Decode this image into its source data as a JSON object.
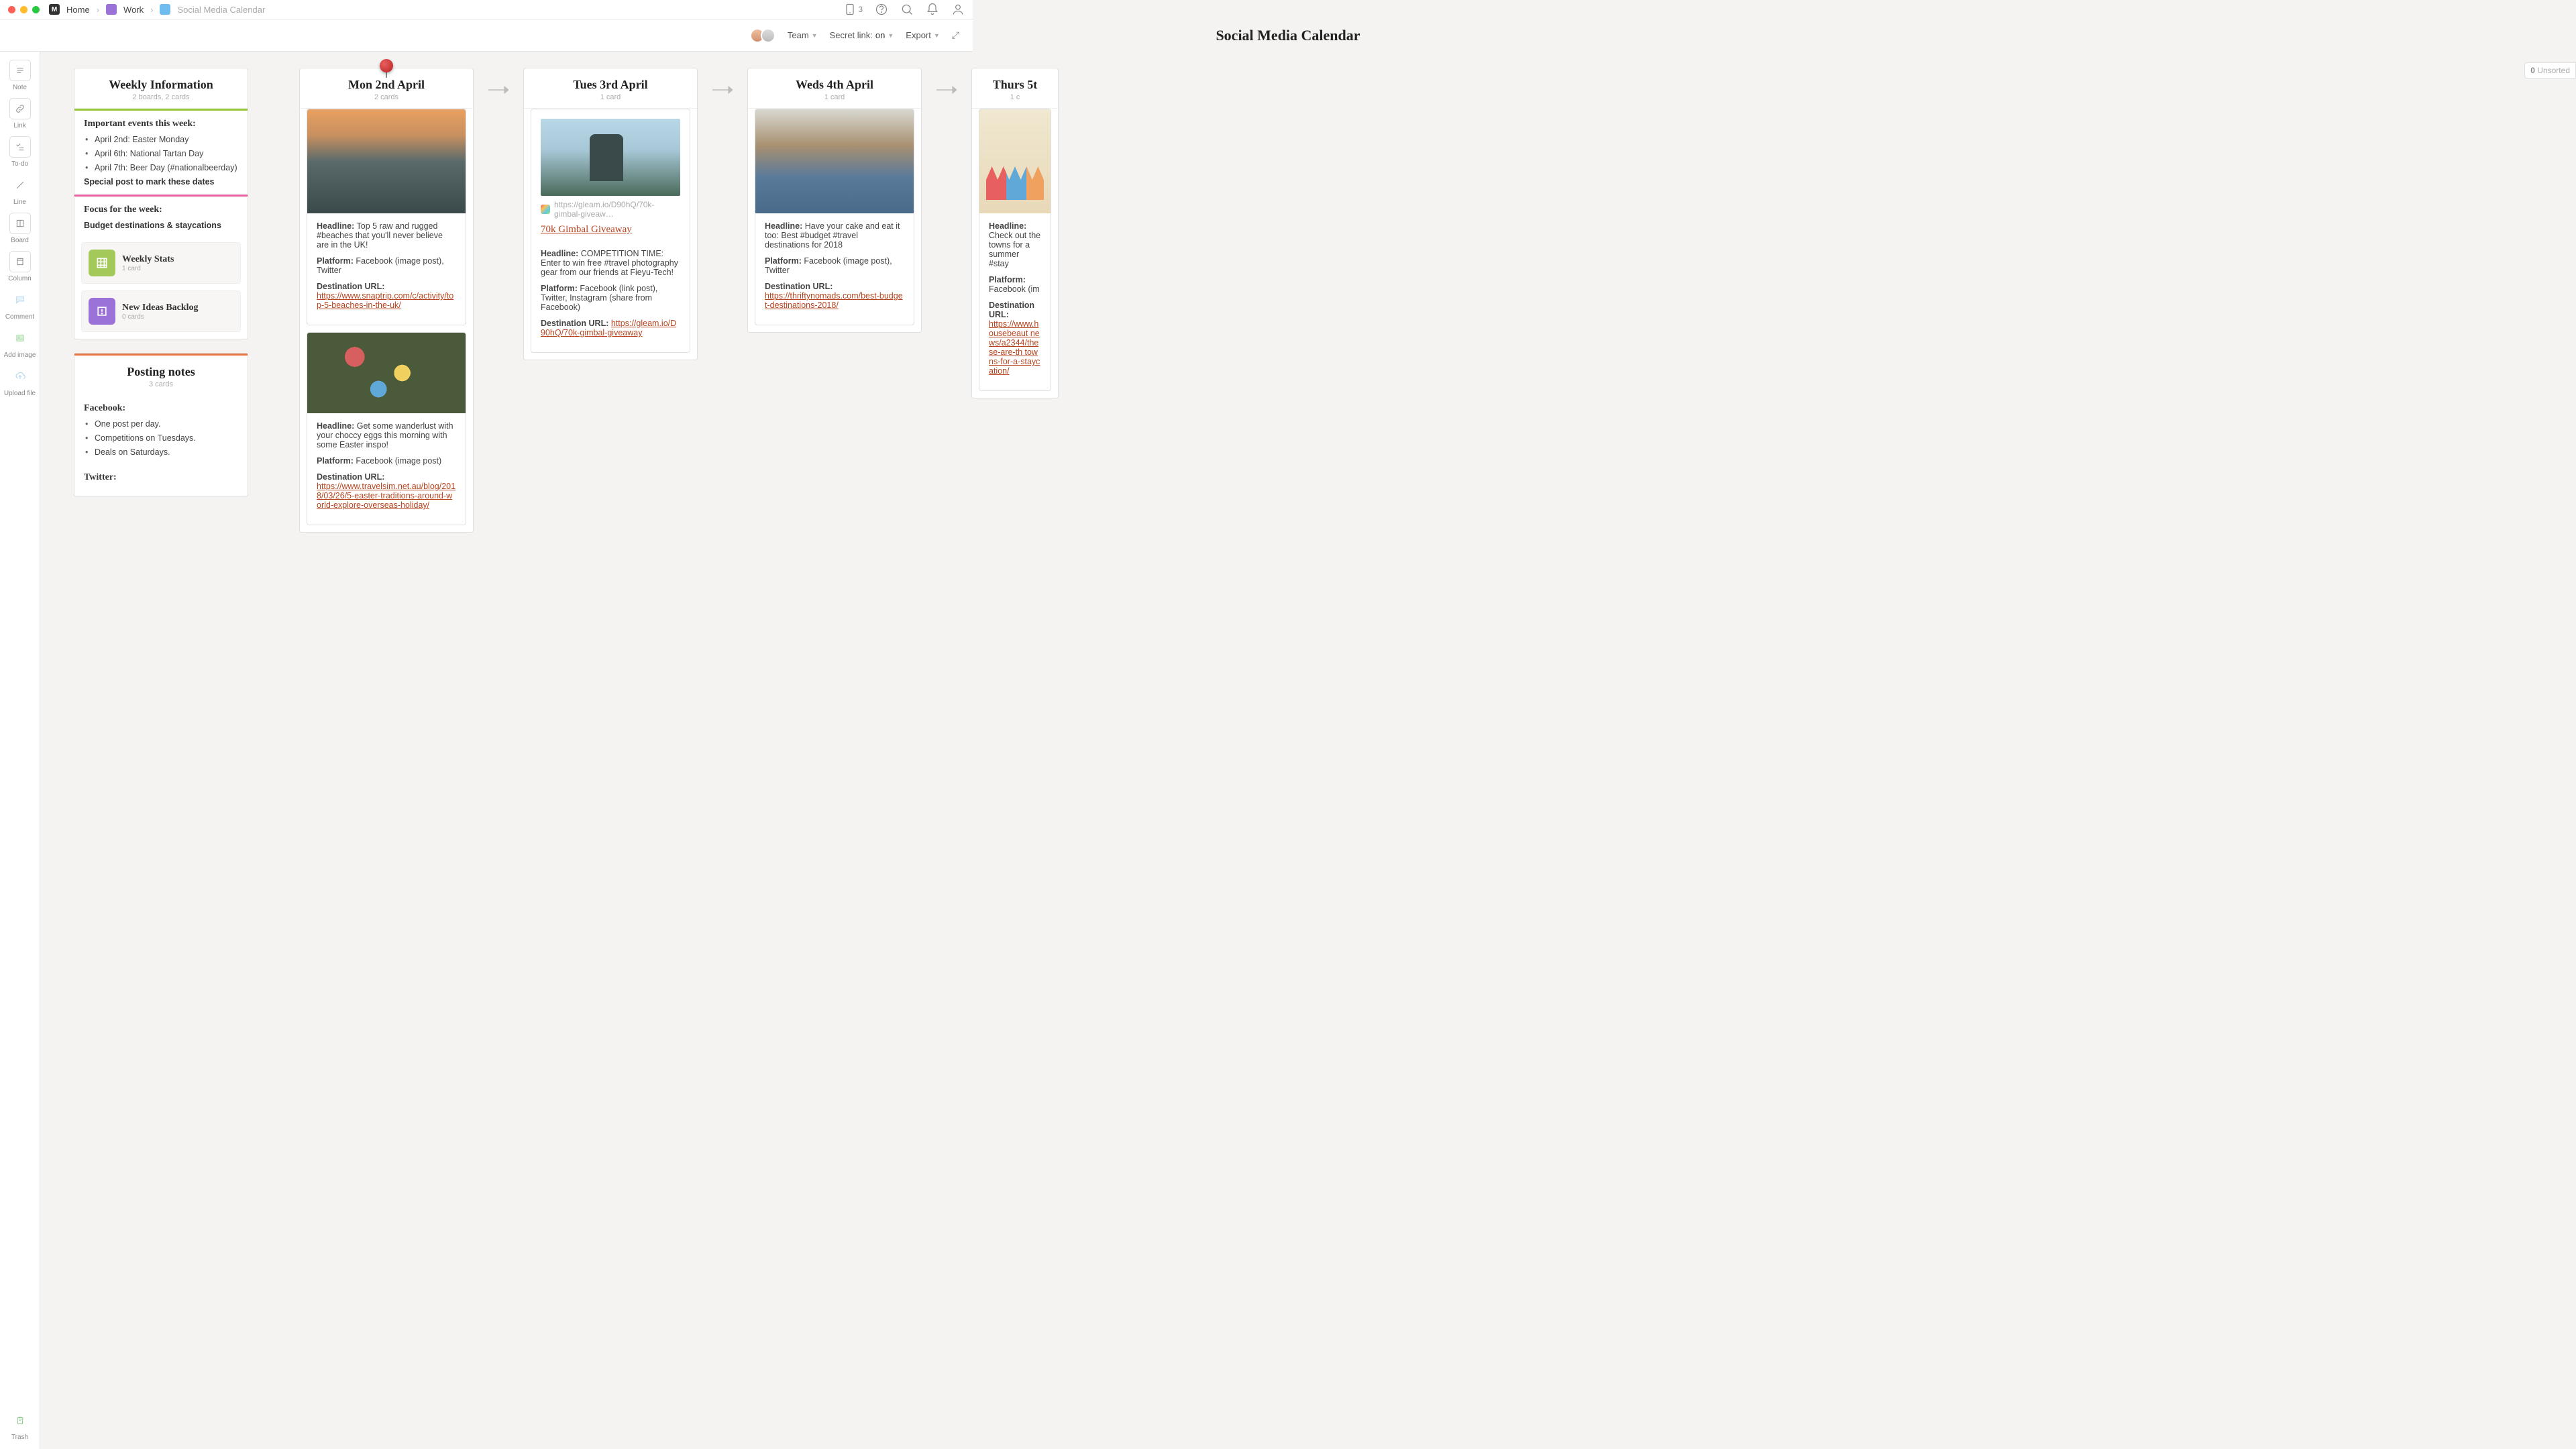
{
  "breadcrumb": {
    "home": "Home",
    "work": "Work",
    "current": "Social Media Calendar"
  },
  "topbar": {
    "device_count": "3"
  },
  "header": {
    "title": "Social Media Calendar",
    "team": "Team",
    "secret": "Secret link:",
    "secret_state": "on",
    "export": "Export"
  },
  "unsorted": {
    "count": "0",
    "label": "Unsorted"
  },
  "sidebar": {
    "note": "Note",
    "link": "Link",
    "todo": "To-do",
    "line": "Line",
    "board": "Board",
    "column": "Column",
    "comment": "Comment",
    "add_image": "Add image",
    "upload": "Upload file",
    "trash": "Trash"
  },
  "weekly": {
    "title": "Weekly Information",
    "sub": "2 boards, 2 cards",
    "events_title": "Important events this week:",
    "events": [
      "April 2nd: Easter Monday",
      "April 6th: National Tartan Day",
      "April 7th: Beer Day (#nationalbeerday)"
    ],
    "special": "Special post to mark these dates",
    "focus_title": "Focus for the week:",
    "focus_text": "Budget destinations & staycations",
    "stats": {
      "title": "Weekly Stats",
      "sub": "1 card"
    },
    "backlog": {
      "title": "New Ideas Backlog",
      "sub": "0 cards"
    }
  },
  "posting": {
    "title": "Posting notes",
    "sub": "3 cards",
    "fb_title": "Facebook:",
    "fb_items": [
      "One post per day.",
      "Competitions on Tuesdays.",
      "Deals on Saturdays."
    ],
    "tw_title": "Twitter:"
  },
  "days": {
    "mon": {
      "title": "Mon 2nd April",
      "sub": "2 cards",
      "card1": {
        "headline_l": "Headline:",
        "headline": "Top 5 raw and rugged #beaches that you'll never believe are in the UK!",
        "platform_l": "Platform:",
        "platform": "Facebook (image post), Twitter",
        "dest_l": "Destination URL:",
        "dest": "https://www.snaptrip.com/c/activity/top-5-beaches-in-the-uk/"
      },
      "card2": {
        "headline_l": "Headline:",
        "headline": "Get some wanderlust with your choccy eggs this morning with some Easter inspo!",
        "platform_l": "Platform:",
        "platform": "Facebook (image post)",
        "dest_l": "Destination URL:",
        "dest": "https://www.travelsim.net.au/blog/2018/03/26/5-easter-traditions-around-world-explore-overseas-holiday/"
      }
    },
    "tue": {
      "title": "Tues 3rd April",
      "sub": "1 card",
      "link_url": "https://gleam.io/D90hQ/70k-gimbal-giveaw…",
      "link_title": "70k Gimbal Giveaway",
      "headline_l": "Headline:",
      "headline": "COMPETITION TIME: Enter to win free #travel photography gear from our friends at Fieyu-Tech!",
      "platform_l": "Platform:",
      "platform": "Facebook (link post), Twitter, Instagram (share from Facebook)",
      "dest_l": "Destination URL:",
      "dest": "https://gleam.io/D90hQ/70k-gimbal-giveaway"
    },
    "wed": {
      "title": "Weds 4th April",
      "sub": "1 card",
      "headline_l": "Headline:",
      "headline": "Have your cake and eat it too: Best #budget #travel destinations for 2018",
      "platform_l": "Platform:",
      "platform": "Facebook (image post), Twitter",
      "dest_l": "Destination URL:",
      "dest": "https://thriftynomads.com/best-budget-destinations-2018/"
    },
    "thu": {
      "title": "Thurs 5t",
      "sub": "1 c",
      "headline_l": "Headline:",
      "headline": "Check out the towns for a summer #stay",
      "platform_l": "Platform:",
      "platform": "Facebook (im",
      "dest_l": "Destination URL:",
      "dest": "https://www.housebeaut news/a2344/these-are-th towns-for-a-staycation/"
    }
  }
}
